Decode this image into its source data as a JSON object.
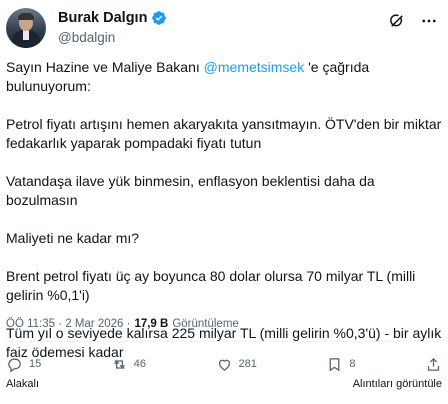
{
  "author": {
    "display_name": "Burak Dalgın",
    "handle": "@bdalgin",
    "avatar_icon": "person-portrait"
  },
  "tweet": {
    "line1_prefix": "Sayın Hazine ve Maliye Bakanı ",
    "line1_mention": "@memetsimsek",
    "line1_suffix": " 'e çağrıda bulunuyorum:",
    "para2": "Petrol fiyatı artışını hemen akaryakıta yansıtmayın. ÖTV'den bir miktar fedakarlık yaparak pompadaki fiyatı tutun",
    "para3": "Vatandaşa ilave yük binmesin, enflasyon beklentisi daha da bozulmasın",
    "para4": "Maliyeti ne kadar mı?",
    "para5": "Brent petrol fiyatı üç ay boyunca 80 dolar olursa 70 milyar TL (milli gelirin %0,1'i)",
    "para6": "Tüm yıl o seviyede kalırsa 225 milyar TL (milli gelirin %0,3'ü) - bir aylık faiz ödemesi kadar"
  },
  "meta": {
    "time_date": "ÖÖ 11:35 · 2 Mar 2026 ·",
    "views_count": "17,9 B",
    "views_label": "Görüntüleme"
  },
  "actions": {
    "replies": "15",
    "reposts": "46",
    "likes": "281",
    "bookmarks": "8"
  },
  "footer": {
    "quotes_label": "Alakalı",
    "views_link": "Alıntıları görüntüle"
  },
  "colors": {
    "accent": "#1d9bf0",
    "secondary_text": "#536471"
  }
}
